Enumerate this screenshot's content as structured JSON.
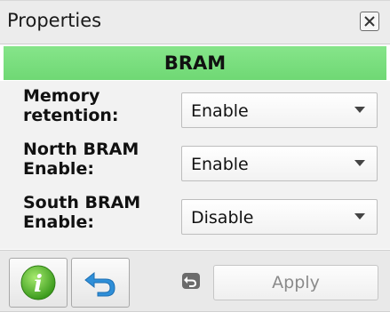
{
  "panel": {
    "title": "Properties",
    "close_icon": "close-box-icon"
  },
  "section": {
    "header": "BRAM",
    "header_color": "#7ddf80"
  },
  "rows": [
    {
      "label": "Memory retention:",
      "value": "Enable"
    },
    {
      "label": "North BRAM Enable:",
      "value": "Enable"
    },
    {
      "label": "South BRAM Enable:",
      "value": "Disable"
    }
  ],
  "footer": {
    "info_icon": "info-icon",
    "undo_icon": "undo-arrow-icon",
    "reset_icon": "reset-small-icon",
    "apply_label": "Apply"
  }
}
